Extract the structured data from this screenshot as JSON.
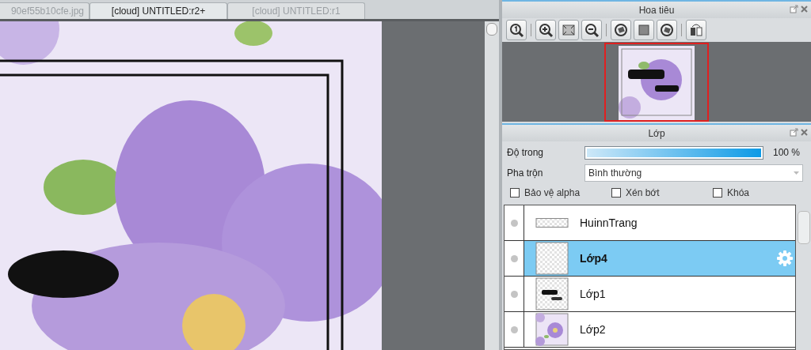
{
  "tabs": [
    {
      "label": "90ef55b10cfe.jpg",
      "selected": false
    },
    {
      "label": "[cloud] UNTITLED:r2+",
      "selected": true
    },
    {
      "label": "[cloud] UNTITLED:r1",
      "selected": false
    }
  ],
  "navigator": {
    "title": "Hoa tiêu"
  },
  "layers_panel": {
    "title": "Lớp",
    "opacity": {
      "label": "Độ trong",
      "level": 1,
      "reading": "100 %"
    },
    "blend": {
      "label": "Pha trộn",
      "value": "Bình thường"
    },
    "options": [
      {
        "label": "Bảo vệ alpha",
        "checked": false
      },
      {
        "label": "Xén bớt",
        "checked": false
      },
      {
        "label": "Khóa",
        "checked": false
      }
    ],
    "layers": [
      {
        "name": "HuinnTrang",
        "kind": "strip",
        "selected": false
      },
      {
        "name": "Lớp4",
        "kind": "empty",
        "selected": true
      },
      {
        "name": "Lớp1",
        "kind": "lettering",
        "selected": false
      },
      {
        "name": "Lớp2",
        "kind": "flowers",
        "selected": false
      }
    ]
  }
}
